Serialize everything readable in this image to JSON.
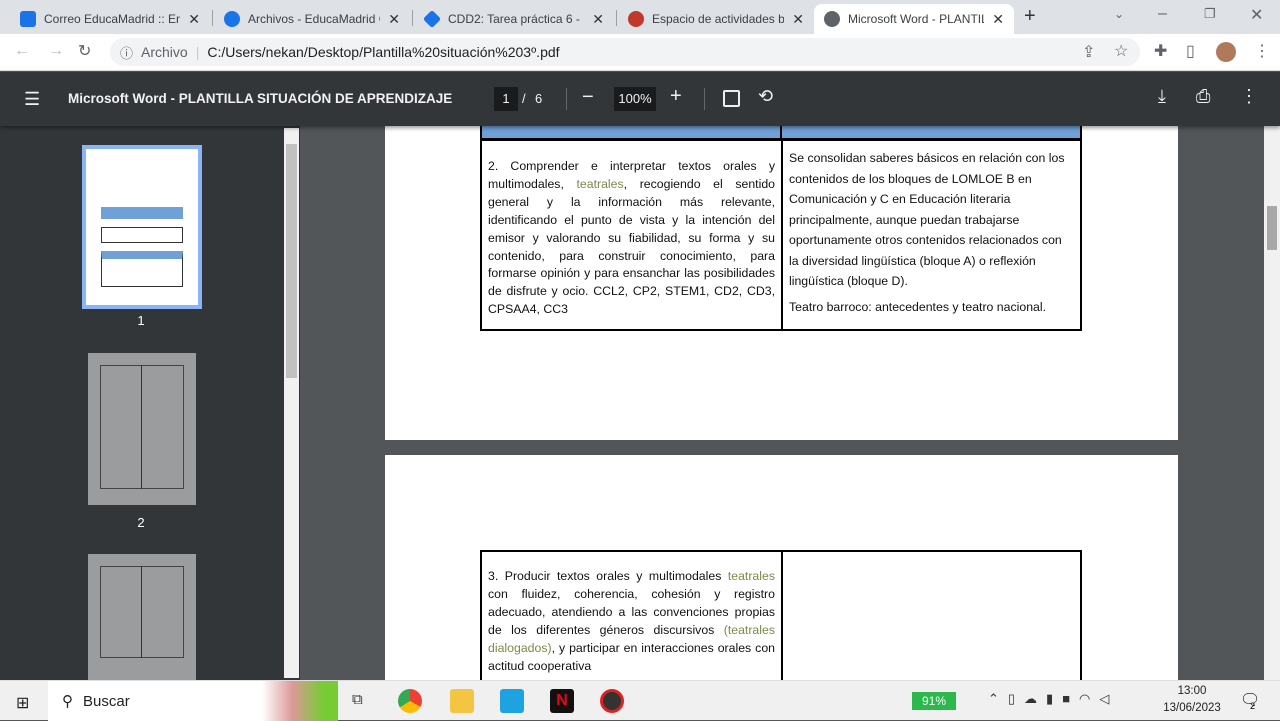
{
  "browser": {
    "tabs": [
      {
        "title": "Correo EducaMadrid :: En",
        "icon": "mail-icon",
        "color": "#1a73e8"
      },
      {
        "title": "Archivos - EducaMadrid C",
        "icon": "cloud-icon",
        "color": "#1a73e8"
      },
      {
        "title": "CDD2: Tarea práctica 6 - M",
        "icon": "graduation-cap-icon",
        "color": "#1a73e8"
      },
      {
        "title": "Espacio de actividades ba",
        "icon": "moodle-icon",
        "color": "#c0392b"
      },
      {
        "title": "Microsoft Word - PLANTIL",
        "icon": "globe-icon",
        "color": "#5f6368"
      }
    ],
    "scheme": "Archivo",
    "url": "C:/Users/nekan/Desktop/Plantilla%20situación%203º.pdf"
  },
  "pdf": {
    "title": "Microsoft Word - PLANTILLA SITUACIÓN DE APRENDIZAJE",
    "page_current": "1",
    "page_sep": "/",
    "page_total": "6",
    "zoom": "100%",
    "thumbnails": [
      "1",
      "2"
    ]
  },
  "document": {
    "row2_left": {
      "a": "2. Comprender e interpretar textos orales y multimodales, ",
      "g": "teatrales",
      "b": ", recogiendo el sentido general y la información más relevante, identificando el punto de vista y la intención del emisor y valorando su fiabilidad, su forma y su contenido, para construir conocimiento, para formarse opinión y para ensanchar las posibilidades de disfrute y ocio. CCL2, CP2, STEM1, CD2, CD3, CPSAA4, CC3"
    },
    "row2_right_p1": "Se consolidan saberes básicos en relación con los contenidos de los bloques de LOMLOE B en Comunicación y C en Educación literaria principalmente, aunque puedan trabajarse oportunamente otros contenidos relacionados con la diversidad lingüística (bloque A) o reflexión lingüística (bloque D).",
    "row2_right_p2": "Teatro barroco: antecedentes y teatro nacional.",
    "row3_left": {
      "a": "3. Producir textos orales y multimodales ",
      "g": "teatrales",
      "b": "  con fluidez, coherencia, cohesión y registro adecuado, atendiendo a las convenciones propias de los diferentes géneros discursivos ",
      "g2": "(teatrales dialogados)",
      "c": ", y participar en interacciones orales con actitud cooperativa"
    }
  },
  "taskbar": {
    "search": "Buscar",
    "battery": "91%",
    "time": "13:00",
    "date": "13/06/2023",
    "notifications": "2"
  }
}
